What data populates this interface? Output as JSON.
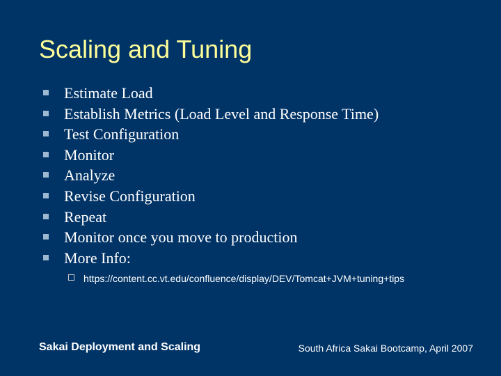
{
  "title": "Scaling and Tuning",
  "bullets": {
    "b0": "Estimate Load",
    "b1": "Establish Metrics (Load Level and Response Time)",
    "b2": "Test Configuration",
    "b3": "Monitor",
    "b4": "Analyze",
    "b5": "Revise Configuration",
    "b6": "Repeat",
    "b7": "Monitor once you move to production",
    "b8": "More Info:"
  },
  "sub": {
    "s0": "https://content.cc.vt.edu/confluence/display/DEV/Tomcat+JVM+tuning+tips"
  },
  "footer": {
    "left": "Sakai Deployment and Scaling",
    "right": "South Africa Sakai Bootcamp, April 2007"
  }
}
